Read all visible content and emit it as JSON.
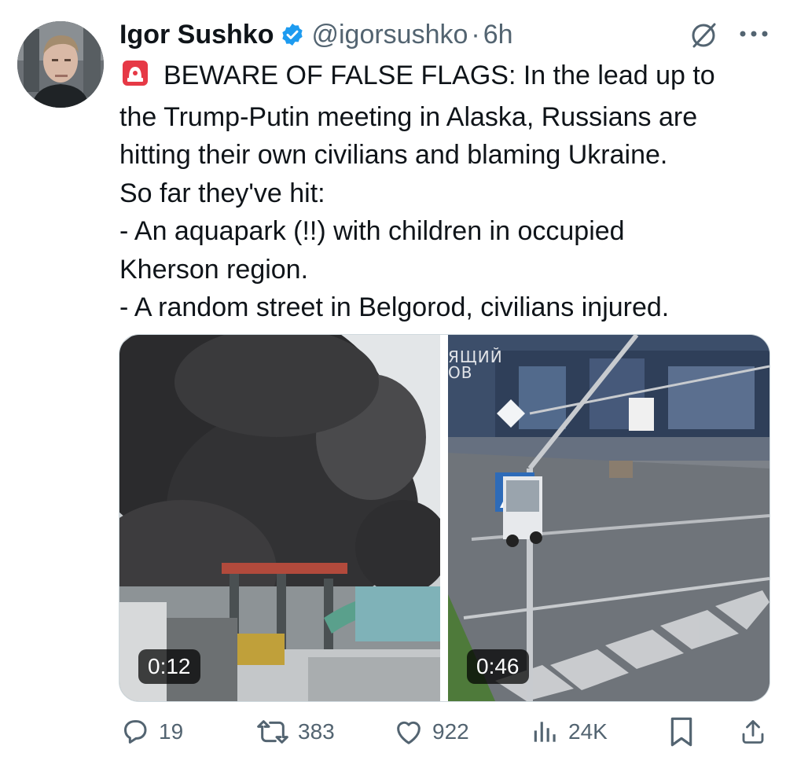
{
  "post": {
    "author_name": "Igor Sushko",
    "handle": "@igorsushko",
    "separator": "·",
    "time": "6h",
    "text_lines": [
      "BEWARE OF FALSE FLAGS: In the lead up to",
      "the Trump-Putin meeting in Alaska, Russians are",
      "hitting their own civilians and blaming Ukraine.",
      "So far they've hit:",
      "- An aquapark (!!) with children in occupied",
      "Kherson region.",
      "- A random street in Belgorod, civilians injured."
    ]
  },
  "media": {
    "videos": [
      {
        "duration": "0:12"
      },
      {
        "duration": "0:46",
        "overlay_text_line1": "ЯЩИЙ",
        "overlay_text_line2": "ОВ"
      }
    ]
  },
  "actions": {
    "replies": "19",
    "reposts": "383",
    "likes": "922",
    "views": "24K"
  },
  "icons": {
    "verified": "verified-badge-icon",
    "siren": "police-siren-emoji",
    "grok": "grok-icon",
    "more": "more-dots-icon",
    "reply": "reply-icon",
    "repost": "repost-icon",
    "like": "heart-icon",
    "views": "views-bar-icon",
    "bookmark": "bookmark-icon",
    "share": "share-icon"
  },
  "colors": {
    "verified_blue": "#1d9bf0",
    "text_primary": "#0f1419",
    "text_secondary": "#536471"
  }
}
